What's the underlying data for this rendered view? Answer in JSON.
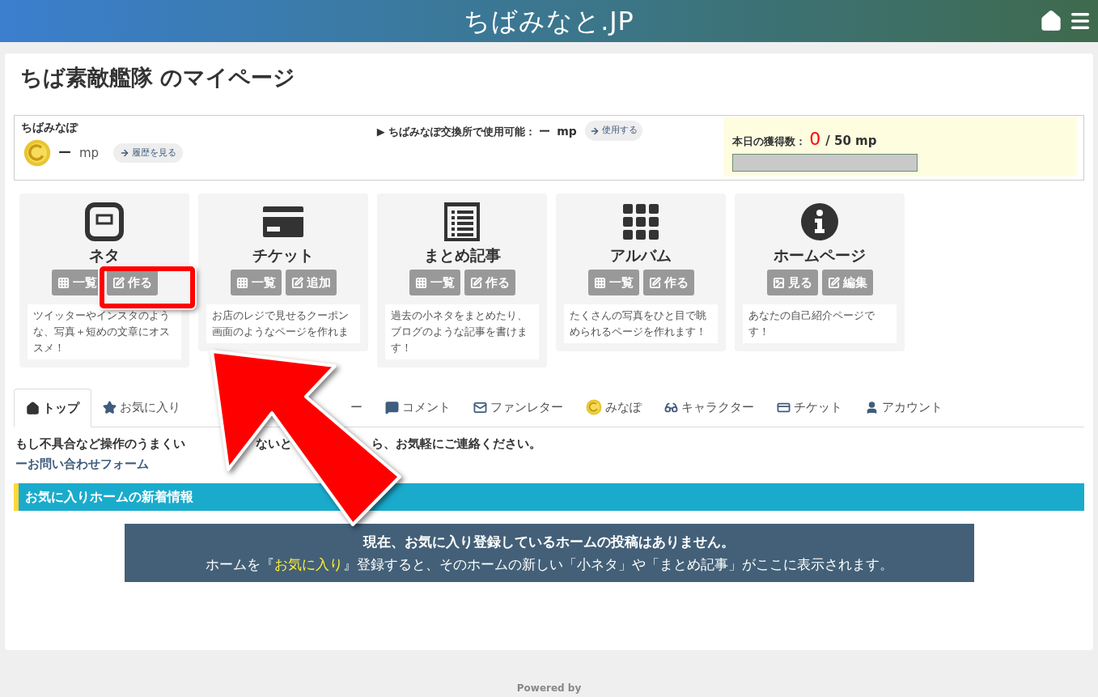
{
  "header": {
    "logo": "ちばみなと.JP"
  },
  "page_title": "ちば素敵艦隊 のマイページ",
  "points": {
    "label": "ちばみなぽ",
    "amount": "ー",
    "unit": "mp",
    "button": "履歴を見る"
  },
  "exchange": {
    "label": "▶ ちばみなぽ交換所で使用可能：",
    "amount": "ー",
    "unit": "mp",
    "button": "使用する"
  },
  "daily": {
    "label": "本日の獲得数：",
    "earned": "0",
    "total": "/ 50 mp",
    "level": 0
  },
  "features": [
    {
      "title": "ネタ",
      "buttons": [
        "一覧",
        "作る"
      ],
      "description": "ツイッターやインスタのような、写真＋短めの文章にオススメ！"
    },
    {
      "title": "チケット",
      "buttons": [
        "一覧",
        "追加"
      ],
      "description": "お店のレジで見せるクーポン画面のようなページを作れま"
    },
    {
      "title": "まとめ記事",
      "buttons": [
        "一覧",
        "作る"
      ],
      "description": "過去の小ネタをまとめたり、ブログのような記事を書けます！"
    },
    {
      "title": "アルバム",
      "buttons": [
        "一覧",
        "作る"
      ],
      "description": "たくさんの写真をひと目で眺められるページを作れます！"
    },
    {
      "title": "ホームページ",
      "buttons": [
        "見る",
        "編集"
      ],
      "description": "あなたの自己紹介ページです！"
    }
  ],
  "tabs": [
    {
      "label": "トップ",
      "selected": true
    },
    {
      "label": "お気に入り",
      "selected": false
    },
    {
      "label": "ー",
      "selected": false
    },
    {
      "label": "コメント",
      "selected": false
    },
    {
      "label": "ファンレター",
      "selected": false
    },
    {
      "label": "みなぽ",
      "selected": false
    },
    {
      "label": "キャラクター",
      "selected": false
    },
    {
      "label": "チケット",
      "selected": false
    },
    {
      "label": "アカウント",
      "selected": false
    }
  ],
  "notice": {
    "fragments": [
      "もし不具合など操作のうまくい",
      "ないと",
      "ら、お気軽にご連絡ください。"
    ],
    "link": "ーお問い合わせフォーム"
  },
  "section": {
    "title": "お気に入りホームの新着情報"
  },
  "message": {
    "headline": "現在、お気に入り登録しているホームの投稿はありません。",
    "parts": [
      {
        "text": "ホームを『",
        "highlight": false
      },
      {
        "text": "お気に入り",
        "highlight": true
      },
      {
        "text": "』登録すると、そのホームの新しい「小ネタ」や「まとめ記事」がここに表示されます。",
        "highlight": false
      }
    ]
  },
  "footer": {
    "text": "Powered by"
  }
}
